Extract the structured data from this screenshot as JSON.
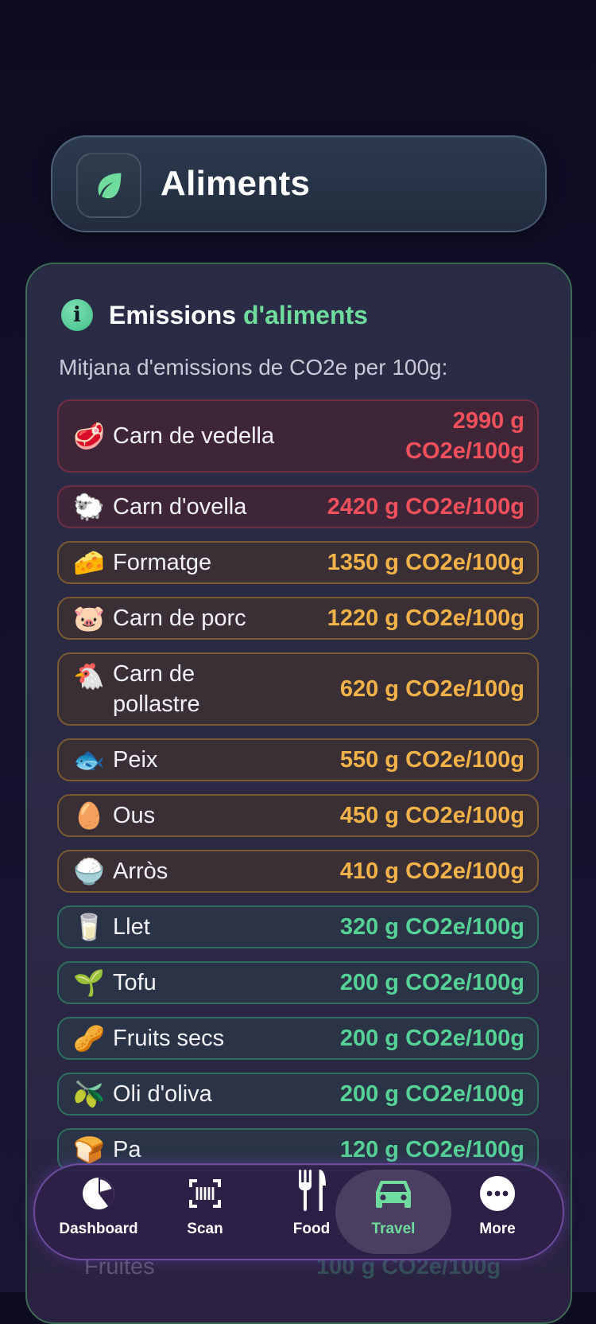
{
  "header": {
    "title": "Aliments",
    "icon": "leaf-icon"
  },
  "panel": {
    "title_part1": "Emissions ",
    "title_part2": "d'aliments",
    "subtitle": "Mitjana d'emissions de CO2e per 100g:",
    "colors": {
      "high": "#f0505c",
      "medium": "#f2b24a",
      "low": "#56d296"
    },
    "items": [
      {
        "emoji": "🥩",
        "name": "Carn de vedella",
        "value": "2990 g CO2e/100g",
        "level": "high"
      },
      {
        "emoji": "🐑",
        "name": "Carn d'ovella",
        "value": "2420 g CO2e/100g",
        "level": "high"
      },
      {
        "emoji": "🧀",
        "name": "Formatge",
        "value": "1350 g CO2e/100g",
        "level": "medium"
      },
      {
        "emoji": "🐷",
        "name": "Carn de porc",
        "value": "1220 g CO2e/100g",
        "level": "medium"
      },
      {
        "emoji": "🐔",
        "name": "Carn de pollastre",
        "value": "620 g CO2e/100g",
        "level": "medium"
      },
      {
        "emoji": "🐟",
        "name": "Peix",
        "value": "550 g CO2e/100g",
        "level": "medium"
      },
      {
        "emoji": "🥚",
        "name": "Ous",
        "value": "450 g CO2e/100g",
        "level": "medium"
      },
      {
        "emoji": "🍚",
        "name": "Arròs",
        "value": "410 g CO2e/100g",
        "level": "medium"
      },
      {
        "emoji": "🥛",
        "name": "Llet",
        "value": "320 g CO2e/100g",
        "level": "low"
      },
      {
        "emoji": "🌱",
        "name": "Tofu",
        "value": "200 g CO2e/100g",
        "level": "low"
      },
      {
        "emoji": "🥜",
        "name": "Fruits secs",
        "value": "200 g CO2e/100g",
        "level": "low"
      },
      {
        "emoji": "🫒",
        "name": "Oli d'oliva",
        "value": "200 g CO2e/100g",
        "level": "low"
      },
      {
        "emoji": "🍞",
        "name": "Pa",
        "value": "120 g CO2e/100g",
        "level": "low"
      }
    ],
    "peek": [
      {
        "name": "Fruites",
        "value": "100 g CO2e/100g"
      }
    ]
  },
  "nav": {
    "items": [
      {
        "label": "Dashboard",
        "icon": "pie-chart-icon"
      },
      {
        "label": "Scan",
        "icon": "barcode-scan-icon"
      },
      {
        "label": "Food",
        "icon": "fork-knife-icon"
      },
      {
        "label": "Travel",
        "icon": "car-icon",
        "active": true
      },
      {
        "label": "More",
        "icon": "more-dots-icon"
      }
    ]
  }
}
